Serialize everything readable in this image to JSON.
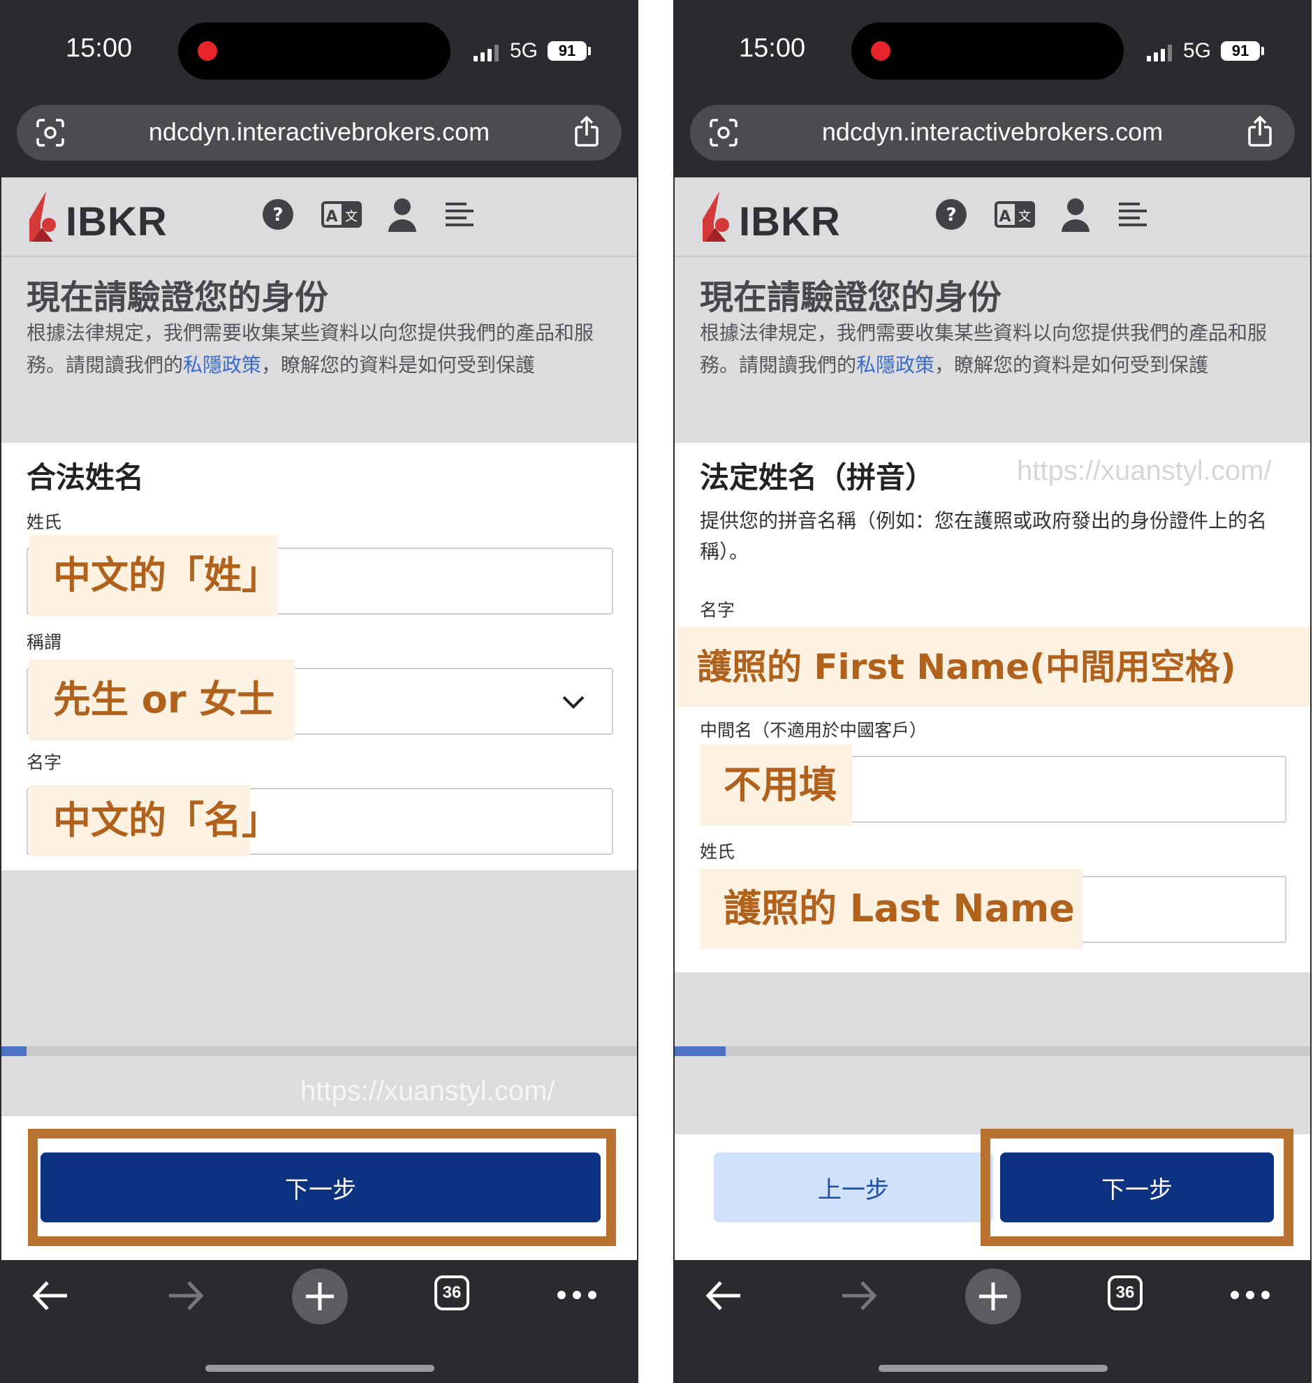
{
  "status": {
    "time": "15:00",
    "network": "5G",
    "battery": "91"
  },
  "browser": {
    "url": "ndcdyn.interactivebrokers.com",
    "tab_count": "36"
  },
  "header": {
    "logo": "IBKR",
    "page_title": "現在請驗證您的身份",
    "desc_before": "根據法律規定，我們需要收集某些資料以向您提供我們的產品和服務。請閱讀我們的",
    "desc_link": "私隱政策",
    "desc_after": "，瞭解您的資料是如何受到保護"
  },
  "left": {
    "section_title": "合法姓名",
    "surname_label": "姓氏",
    "surname_note": "中文的「姓」",
    "title_label": "稱謂",
    "title_note": "先生 or 女士",
    "given_label": "名字",
    "given_note": "中文的「名」",
    "watermark": "https://xuanstyl.com/",
    "next_label": "下一步",
    "progress": 0.04
  },
  "right": {
    "section_title": "法定姓名（拼音）",
    "watermark": "https://xuanstyl.com/",
    "section_desc": "提供您的拼音名稱（例如：您在護照或政府發出的身份證件上的名稱）。",
    "first_label": "名字",
    "first_note": "護照的 First Name(中間用空格)",
    "middle_label": "中間名（不適用於中國客戶）",
    "middle_note": "不用填",
    "last_label": "姓氏",
    "last_note": "護照的 Last Name",
    "prev_label": "上一步",
    "next_label": "下一步",
    "progress": 0.08
  },
  "colors": {
    "primary_button": "#0e3282",
    "secondary_button": "#cfe1fb",
    "annotation_frame": "#b9712f",
    "annotation_text": "#b0621d",
    "progress": "#4d72c4"
  },
  "icons": [
    "scan-icon",
    "share-icon",
    "help-icon",
    "language-icon",
    "account-icon",
    "menu-icon",
    "chevron-down-icon",
    "back-arrow-icon",
    "forward-arrow-icon",
    "plus-icon",
    "tabs-icon",
    "more-icon"
  ]
}
